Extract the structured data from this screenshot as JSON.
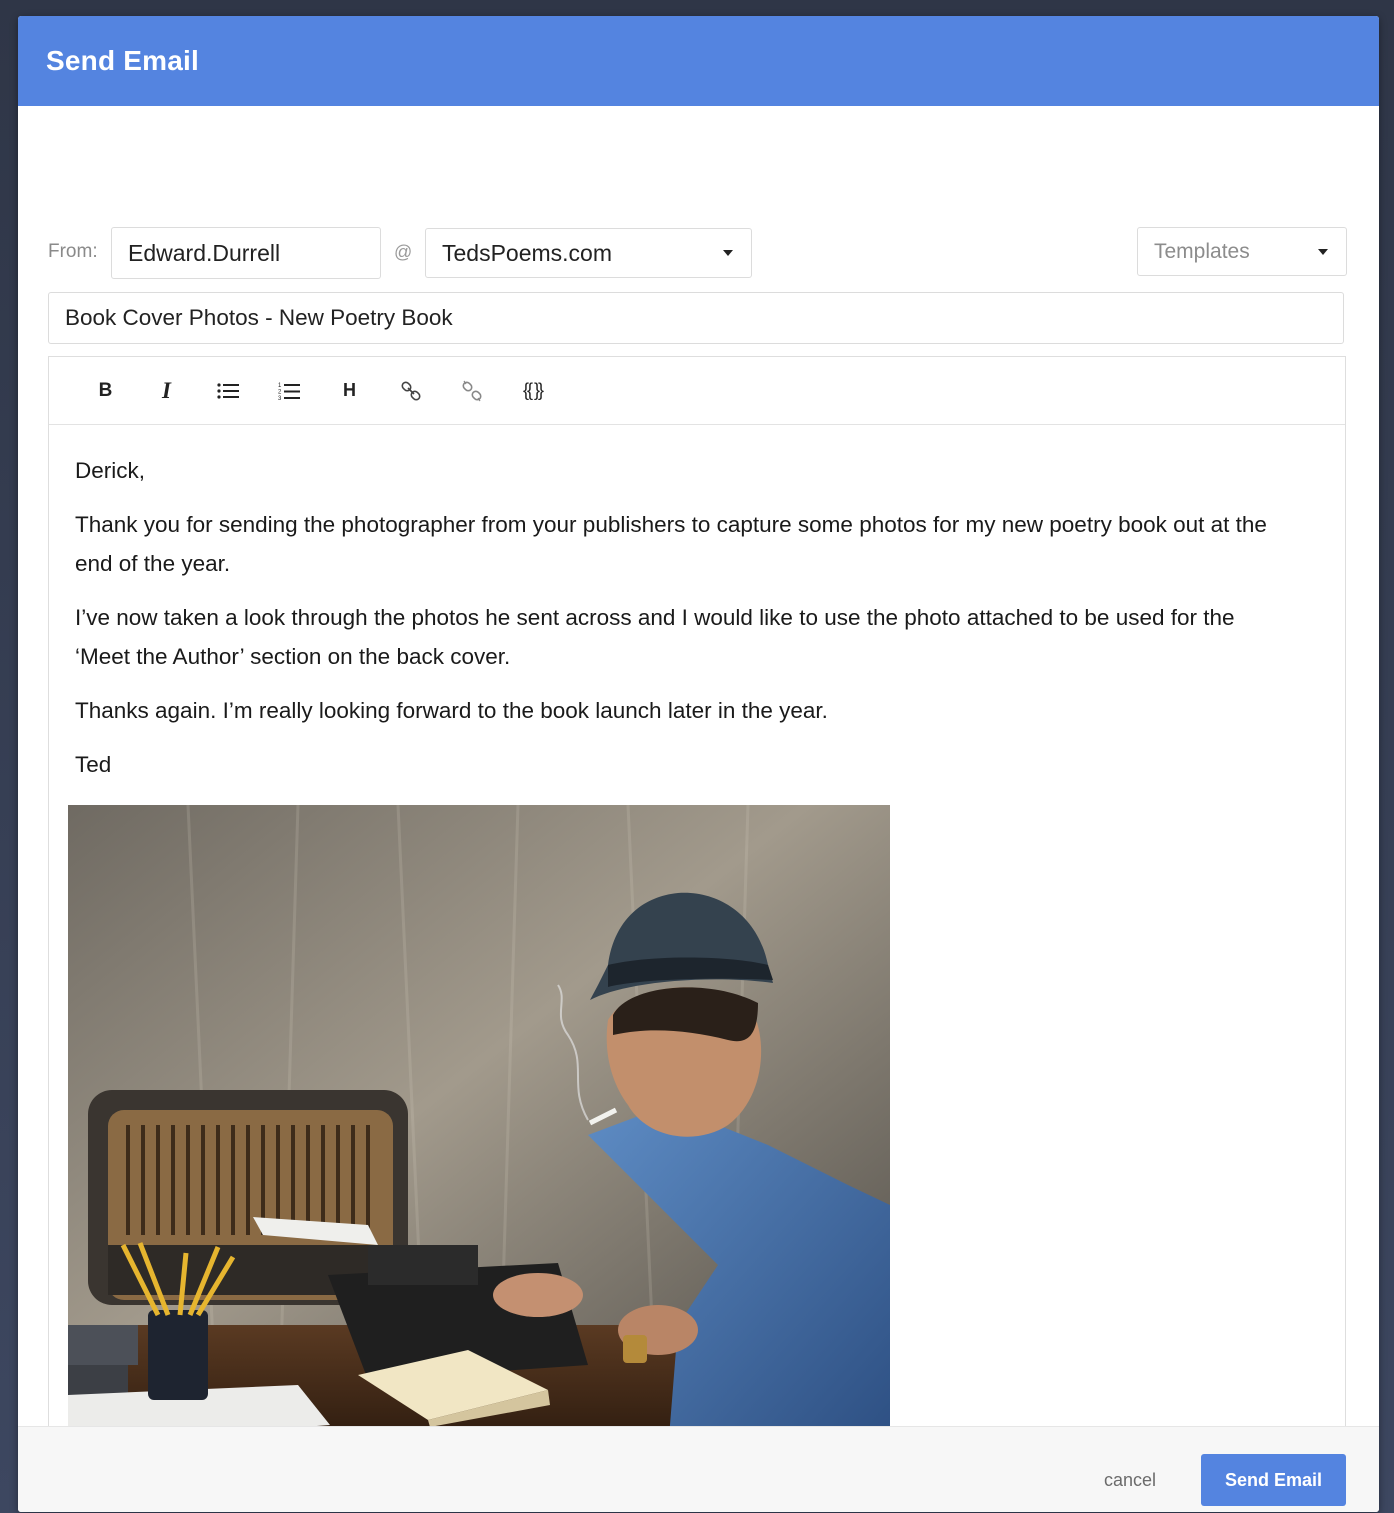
{
  "modal": {
    "title": "Send Email"
  },
  "from": {
    "label": "From:",
    "username": "Edward.Durrell",
    "at": "@",
    "domain": "TedsPoems.com"
  },
  "templates": {
    "placeholder": "Templates"
  },
  "subject": {
    "value": "Book Cover Photos - New Poetry Book"
  },
  "toolbar": {
    "buttons": [
      {
        "icon": "bold-icon",
        "label": "B"
      },
      {
        "icon": "italic-icon",
        "label": "I"
      },
      {
        "icon": "bulleted-list-icon"
      },
      {
        "icon": "numbered-list-icon"
      },
      {
        "icon": "heading-icon",
        "label": "H"
      },
      {
        "icon": "link-icon"
      },
      {
        "icon": "unlink-icon"
      },
      {
        "icon": "template-variable-icon",
        "label": "{{ }}"
      }
    ]
  },
  "body": {
    "greeting": "Derick,",
    "paragraph1": "Thank you for sending the photographer from your publishers to capture some photos for my new poetry book out at the end of the year.",
    "paragraph2": "I’ve now taken a look through the photos he sent across and I would like to use the photo attached to be used for the ‘Meet the Author’ section on the back cover.",
    "paragraph3": "Thanks again. I’m really looking forward to the book launch later in the year.",
    "signature": "Ted"
  },
  "footer": {
    "cancel_label": "cancel",
    "send_label": "Send Email"
  },
  "colors": {
    "accent": "#5484e0",
    "header_bg": "#5484e0"
  }
}
